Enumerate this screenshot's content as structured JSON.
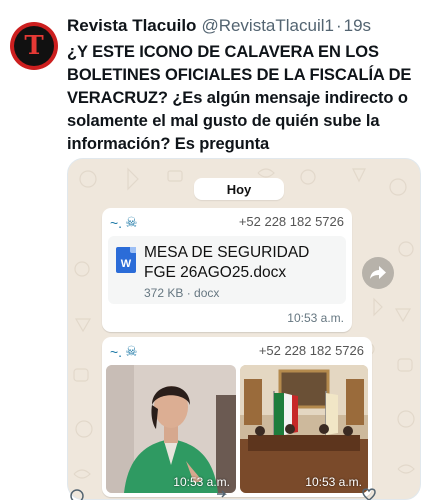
{
  "tweet": {
    "author_name": "Revista Tlacuilo",
    "author_handle": "@RevistaTlacuil1",
    "separator": "·",
    "time": "19s",
    "avatar_letter": "T",
    "text": "¿Y ESTE ICONO DE CALAVERA EN LOS BOLETINES OFICIALES DE LA FISCALÍA DE VERACRUZ? ¿Es algún mensaje indirecto o solamente el mal gusto de quién sube la información? Es pregunta"
  },
  "chat": {
    "date_chip": "Hoy",
    "message1": {
      "sender": "~.",
      "sender_icon": "skull-icon",
      "phone": "+52 228 182 5726",
      "doc_icon_label": "W",
      "doc_name": "MESA DE SEGURIDAD FGE 26AGO25.docx",
      "doc_meta": "372 KB · docx",
      "time": "10:53 a.m."
    },
    "message2": {
      "sender": "~.",
      "sender_icon": "skull-icon",
      "phone": "+52 228 182 5726",
      "photo1_time": "10:53 a.m.",
      "photo2_time": "10:53 a.m."
    }
  },
  "colors": {
    "avatar_bg": "#cc1f1f",
    "chat_bg": "#efe7dc",
    "sender": "#1f7aa8",
    "doc_icon": "#2b6cd8"
  }
}
